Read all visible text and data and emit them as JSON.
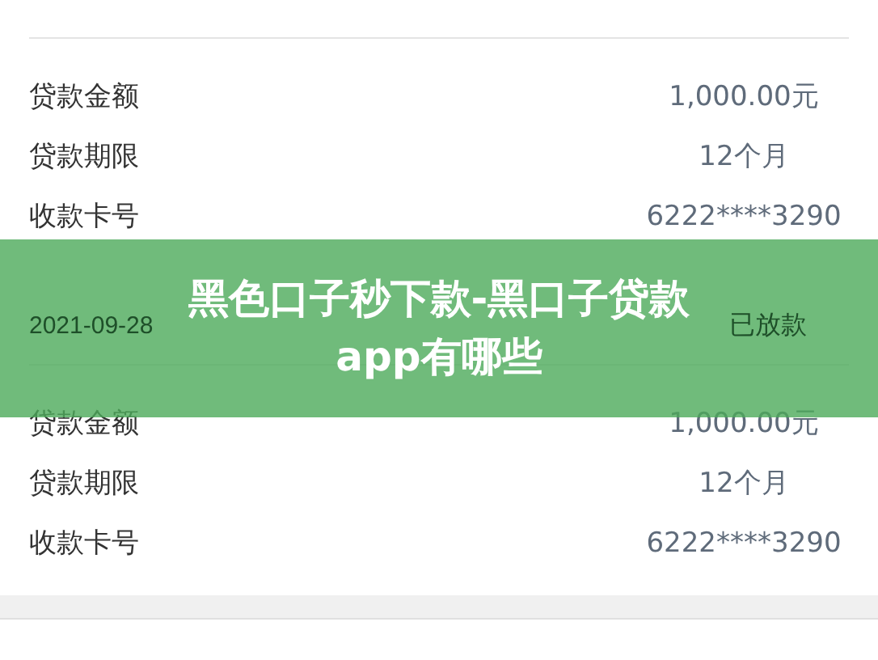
{
  "cards": [
    {
      "rows": [
        {
          "label": "贷款金额",
          "value": "1,000.00元"
        },
        {
          "label": "贷款期限",
          "value": "12个月"
        },
        {
          "label": "收款卡号",
          "value": "6222****3290"
        }
      ]
    },
    {
      "date": "2021-09-28",
      "status": "已放款",
      "rows": [
        {
          "label": "贷款金额",
          "value": "1,000.00元"
        },
        {
          "label": "贷款期限",
          "value": "12个月"
        },
        {
          "label": "收款卡号",
          "value": "6222****3290"
        }
      ]
    }
  ],
  "banner": {
    "title": "黑色口子秒下款-黑口子贷款app有哪些"
  }
}
